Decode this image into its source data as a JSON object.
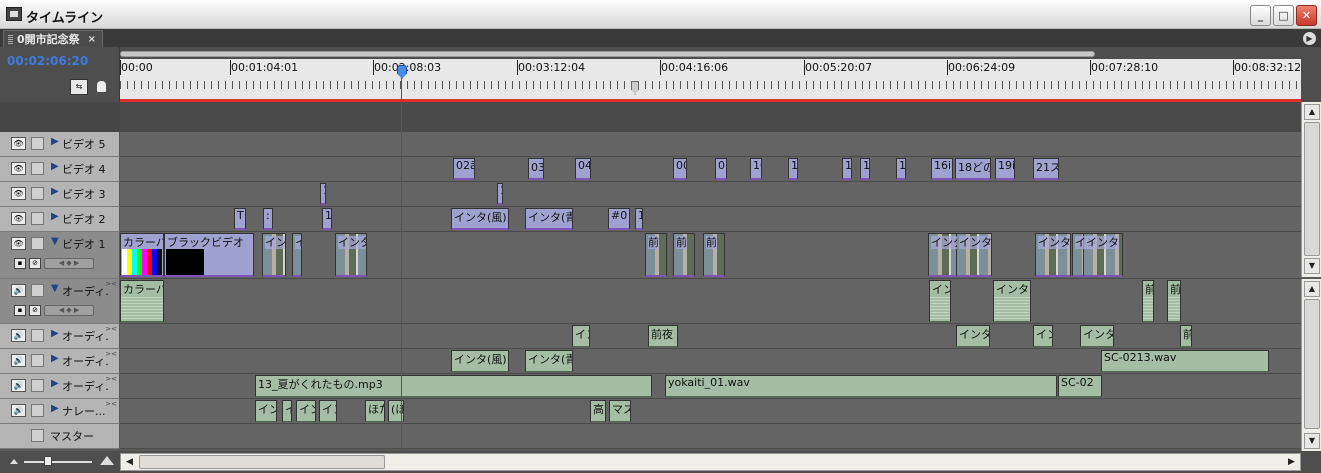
{
  "window": {
    "title": "タイムライン"
  },
  "tab": {
    "label": "0開市記念祭",
    "close": "×"
  },
  "timecode": "00:02:06:20",
  "ruler": {
    "labels": [
      "00:00",
      "00:01:04:01",
      "00:02:08:03",
      "00:03:12:04",
      "00:04:16:06",
      "00:05:20:07",
      "00:06:24:09",
      "00:07:28:10",
      "00:08:32:12"
    ]
  },
  "tracks": [
    {
      "id": "video5",
      "name": "ビデオ 5",
      "kind": "video",
      "clips": []
    },
    {
      "id": "video4",
      "name": "ビデオ 4",
      "kind": "video",
      "clips": [
        "02ā",
        "03ど",
        "04",
        "00",
        "0",
        "10",
        "1",
        "1",
        "1",
        "1",
        "16ⅰ",
        "18どの",
        "19ⅰ",
        "21ス"
      ]
    },
    {
      "id": "video3",
      "name": "ビデオ 3",
      "kind": "video",
      "clips": [
        "1",
        "1"
      ]
    },
    {
      "id": "video2",
      "name": "ビデオ 2",
      "kind": "video",
      "clips": [
        "T",
        ":",
        "1",
        "インタ(風)",
        "インタ(青",
        "#0",
        "1"
      ]
    },
    {
      "id": "video1",
      "name": "ビデオ 1",
      "kind": "video",
      "clips": [
        "カラーバ",
        "ブラックビデオ",
        "イン",
        "イ",
        "インタ",
        "前",
        "前",
        "前",
        "インタ",
        "インタ",
        "インタ",
        "イン",
        "インタ"
      ]
    },
    {
      "id": "audio1",
      "name": "オーディ...",
      "kind": "audio",
      "clips": [
        "カラーバ",
        "インタ",
        "インタ(",
        "前",
        "前"
      ]
    },
    {
      "id": "audio2",
      "name": "オーディ...",
      "kind": "audio",
      "clips": [
        "イン",
        "前夜",
        "インタ(",
        "イン",
        "インタ(",
        "前"
      ]
    },
    {
      "id": "audio3",
      "name": "オーディ...",
      "kind": "audio",
      "clips": [
        "インタ(風)",
        "インタ(青",
        "SC-0213.wav"
      ]
    },
    {
      "id": "audio4",
      "name": "オーディ...",
      "kind": "audio",
      "clips": [
        "13_夏がくれたもの.mp3",
        "yokaiti_01.wav",
        "SC-02"
      ]
    },
    {
      "id": "narration",
      "name": "ナレー...",
      "kind": "audio",
      "clips": [
        "イン",
        "イ",
        "イン",
        "イン",
        "ほた",
        "(ほ",
        "高",
        "マス"
      ]
    },
    {
      "id": "master",
      "name": "マスター",
      "kind": "master",
      "clips": []
    }
  ]
}
